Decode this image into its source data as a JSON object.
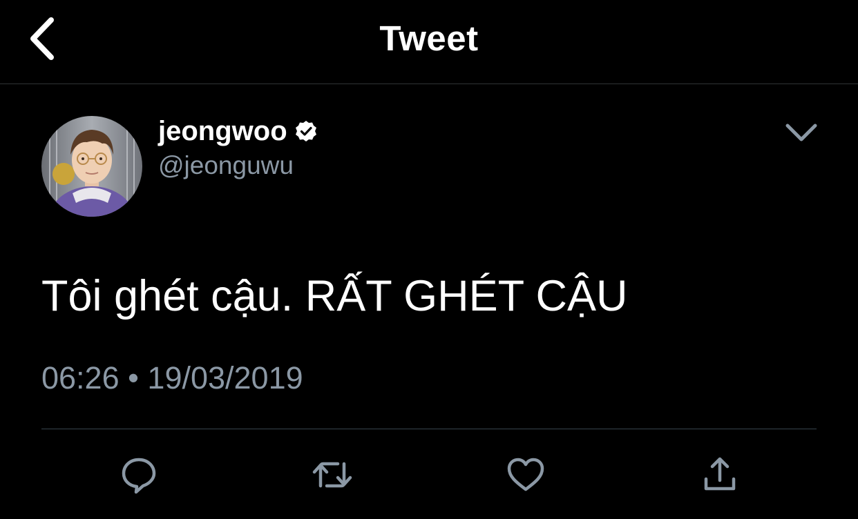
{
  "header": {
    "title": "Tweet",
    "back_icon": "chevron-left-icon"
  },
  "tweet": {
    "author": {
      "display_name": "jeongwoo",
      "handle": "@jeonguwu",
      "verified": true
    },
    "text": "Tôi ghét cậu. RẤT GHÉT CẬU",
    "time": "06:26",
    "separator": "•",
    "date": "19/03/2019"
  },
  "actions": [
    {
      "name": "reply",
      "icon": "comment-icon"
    },
    {
      "name": "retweet",
      "icon": "retweet-icon"
    },
    {
      "name": "like",
      "icon": "heart-icon"
    },
    {
      "name": "share",
      "icon": "share-icon"
    }
  ],
  "colors": {
    "background": "#000000",
    "text": "#ffffff",
    "secondary": "#8b98a5",
    "divider": "#38444d",
    "icon": "#8b98a5"
  }
}
